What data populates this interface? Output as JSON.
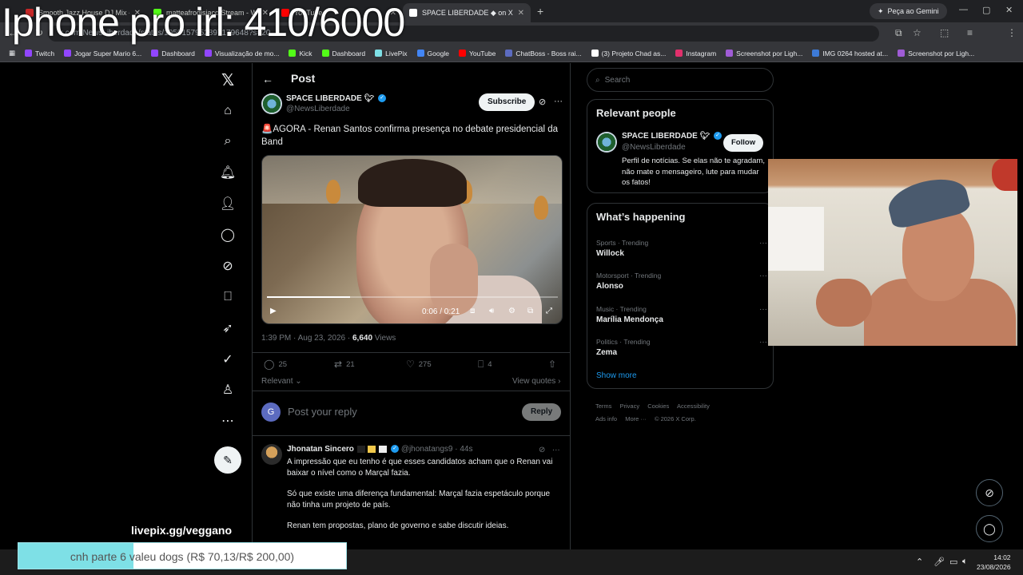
{
  "browser": {
    "tabs": [
      {
        "label": "Smooth Jazz House DJ Mix - Co",
        "color": "#c62828"
      },
      {
        "label": "matteafrodisiaco Stream - Wats",
        "color": "#53fc18"
      },
      {
        "label": "YouTube",
        "color": "#ff0000"
      },
      {
        "label": "SPACE LIBERDADE ◆ on X:",
        "color": "#ffffff"
      }
    ],
    "new_tab": "+",
    "gemini": "Peça ao Gemini",
    "url": "x.com/NewsLiberdade/status/1959157952897179648?s=20",
    "profile_initial": "G",
    "bookmarks": [
      {
        "label": "Twitch",
        "color": "#9146ff"
      },
      {
        "label": "Jogar Super Mario 6...",
        "color": "#9146ff"
      },
      {
        "label": "Dashboard",
        "color": "#9146ff"
      },
      {
        "label": "Visualização de mo...",
        "color": "#9146ff"
      },
      {
        "label": "Kick",
        "color": "#53fc18"
      },
      {
        "label": "Dashboard",
        "color": "#53fc18"
      },
      {
        "label": "LivePix",
        "color": "#7ee0e6"
      },
      {
        "label": "Google",
        "color": "#4285f4"
      },
      {
        "label": "YouTube",
        "color": "#ff0000"
      },
      {
        "label": "ChatBoss - Boss rai...",
        "color": "#5c6bc0"
      },
      {
        "label": "(3) Projeto Chad as...",
        "color": "#ffffff"
      },
      {
        "label": "Instagram",
        "color": "#e1306c"
      },
      {
        "label": "Screenshot por Ligh...",
        "color": "#a05cd6"
      },
      {
        "label": "IMG 0264 hosted at...",
        "color": "#3d7ad6"
      },
      {
        "label": "Screenshot por Ligh...",
        "color": "#a05cd6"
      }
    ]
  },
  "stream": {
    "title": "Iphone pro irl: 410/6000",
    "livepix": "livepix.gg/veggano",
    "goal_text": "cnh parte 6 valeu dogs (R$ 70,13/R$ 200,00)",
    "goal_progress": 0.35
  },
  "post": {
    "header": "Post",
    "author_name": "SPACE LIBERDADE",
    "author_handle": "@NewsLiberdade",
    "subscribe": "Subscribe",
    "text": "🚨AGORA - Renan Santos confirma presença no debate presidencial da Band",
    "video_time": "0:06 / 0:21",
    "video_progress": 0.286,
    "time": "1:39 PM",
    "date": "Aug 23, 2026",
    "views_count": "6,640",
    "views_label": "Views",
    "replies": "25",
    "reposts": "21",
    "likes": "275",
    "bookmarks": "4",
    "relevant": "Relevant",
    "view_quotes": "View quotes"
  },
  "reply": {
    "avatar": "G",
    "placeholder": "Post your reply",
    "button": "Reply"
  },
  "comment": {
    "name": "Jhonatan Sincero",
    "handle": "@jhonatangs9",
    "age": "44s",
    "paragraphs": [
      "A impressão que eu tenho é que esses candidatos acham que o Renan vai baixar o nível como o Marçal fazia.",
      "Só que existe uma diferença fundamental: Marçal fazia espetáculo porque não tinha um projeto de país.",
      "Renan tem propostas, plano de governo e sabe discutir ideias."
    ]
  },
  "sidebar": {
    "search_placeholder": "Search",
    "relevant_title": "Relevant people",
    "person_name": "SPACE LIBERDADE",
    "person_handle": "@NewsLiberdade",
    "follow": "Follow",
    "bio": "Perfil de notícias. Se elas não te agradam, não mate o mensageiro, lute para mudar os fatos!",
    "happening_title": "What’s happening",
    "trends": [
      {
        "category": "Sports · Trending",
        "topic": "Willock"
      },
      {
        "category": "Motorsport · Trending",
        "topic": "Alonso"
      },
      {
        "category": "Music · Trending",
        "topic": "Marília Mendonça"
      },
      {
        "category": "Politics · Trending",
        "topic": "Zema"
      }
    ],
    "show_more": "Show more",
    "footer": [
      "Terms",
      "Privacy",
      "Cookies",
      "Accessibility",
      "Ads info",
      "More ···",
      "© 2026 X Corp."
    ]
  },
  "taskbar": {
    "time": "14:02",
    "date": "23/08/2026"
  }
}
